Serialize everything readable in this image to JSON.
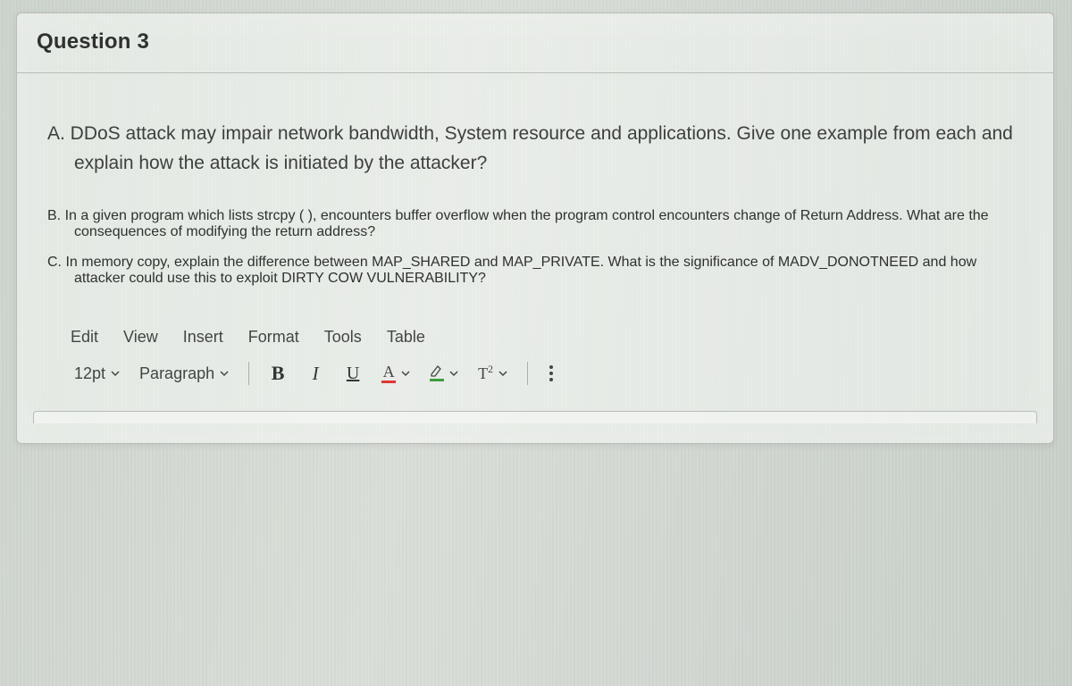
{
  "header": {
    "title": "Question 3"
  },
  "question": {
    "partA": "A. DDoS attack may impair network bandwidth, System resource and applications. Give one example from each and explain how the attack is initiated by the attacker?",
    "partB": "B.  In a given program which lists strcpy ( ), encounters buffer overflow when the program control encounters change of Return Address. What are the consequences of modifying the return address?",
    "partC": "C. In memory copy, explain the difference between MAP_SHARED and MAP_PRIVATE. What is the significance of MADV_DONOTNEED and how attacker could use this to exploit DIRTY COW VULNERABILITY?"
  },
  "editor": {
    "menu": {
      "edit": "Edit",
      "view": "View",
      "insert": "Insert",
      "format": "Format",
      "tools": "Tools",
      "table": "Table"
    },
    "toolbar": {
      "font_size": "12pt",
      "block_format": "Paragraph",
      "bold": "B",
      "italic": "I",
      "underline": "U",
      "text_color_glyph": "A",
      "superscript_glyph": "T"
    }
  }
}
